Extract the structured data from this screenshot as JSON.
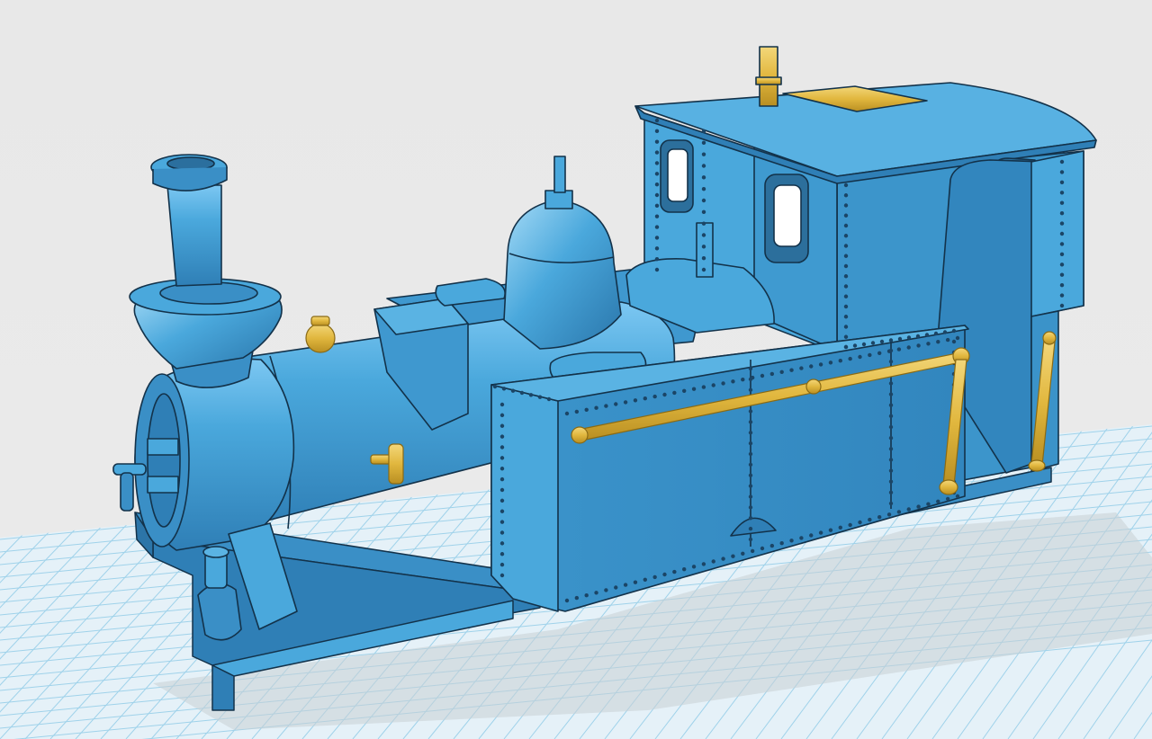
{
  "viewport": {
    "background_color": "#e9e9e9",
    "grid_color": "#9fd2ea",
    "grid_fill": "#e7f3f9"
  },
  "model": {
    "name_icon": "locomotive-model",
    "primary_color": "#4aa8dc",
    "shade_color": "#2f7fb6",
    "highlight_color": "#7cc7f2",
    "accent_color": "#e8c24a",
    "outline_color": "#13324a"
  }
}
